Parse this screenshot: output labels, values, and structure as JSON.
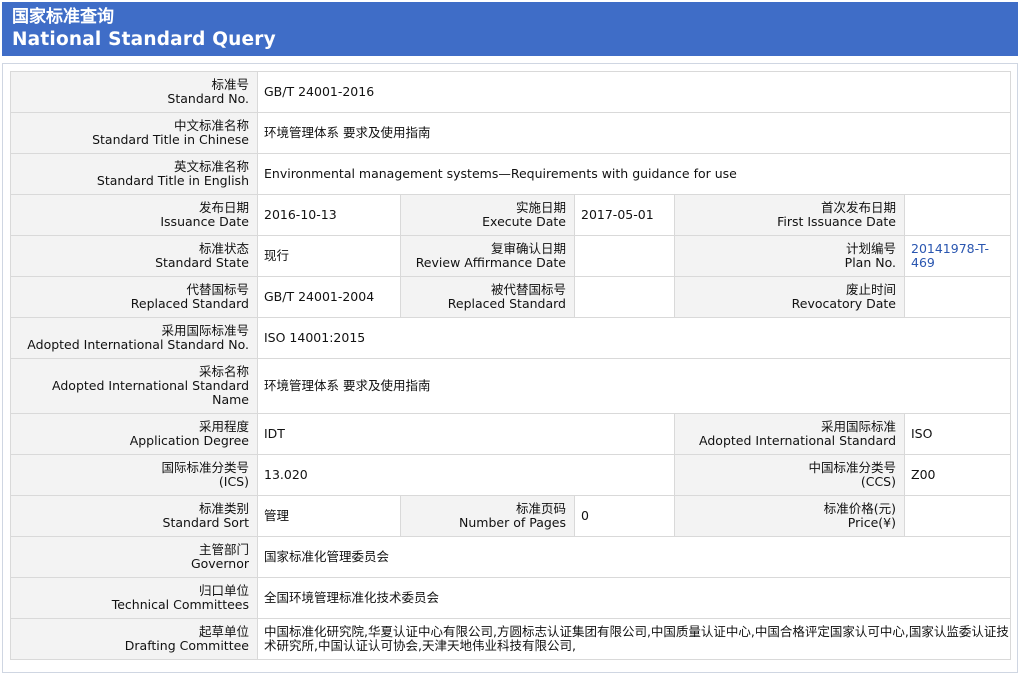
{
  "header": {
    "title_cn": "国家标准查询",
    "title_en": "National Standard Query"
  },
  "rows": {
    "standard_no": {
      "cn": "标准号",
      "en": "Standard No.",
      "value": "GB/T 24001-2016"
    },
    "title_cn": {
      "cn": "中文标准名称",
      "en": "Standard Title in Chinese",
      "value": "环境管理体系 要求及使用指南"
    },
    "title_en": {
      "cn": "英文标准名称",
      "en": "Standard Title in English",
      "value": "Environmental management systems—Requirements with guidance for use"
    },
    "issuance": {
      "cn": "发布日期",
      "en": "Issuance Date",
      "value": "2016-10-13"
    },
    "execute": {
      "cn": "实施日期",
      "en": "Execute Date",
      "value": "2017-05-01"
    },
    "first_issuance": {
      "cn": "首次发布日期",
      "en": "First Issuance Date",
      "value": ""
    },
    "state": {
      "cn": "标准状态",
      "en": "Standard State",
      "value": "现行"
    },
    "review": {
      "cn": "复审确认日期",
      "en": "Review Affirmance Date",
      "value": ""
    },
    "plan_no": {
      "cn": "计划编号",
      "en": "Plan No.",
      "value_line1": "20141978-T-",
      "value_line2": "469"
    },
    "replaced": {
      "cn": "代替国标号",
      "en": "Replaced Standard",
      "value": "GB/T 24001-2004"
    },
    "replaced_by": {
      "cn": "被代替国标号",
      "en": "Replaced Standard",
      "value": ""
    },
    "revocatory": {
      "cn": "废止时间",
      "en": "Revocatory Date",
      "value": ""
    },
    "adopted_no": {
      "cn": "采用国际标准号",
      "en": "Adopted International Standard No.",
      "value": "ISO 14001:2015"
    },
    "adopted_name": {
      "cn": "采标名称",
      "en_line1": "Adopted International Standard",
      "en_line2": "Name",
      "value": "环境管理体系 要求及使用指南"
    },
    "degree": {
      "cn": "采用程度",
      "en": "Application Degree",
      "value": "IDT"
    },
    "adopted_std": {
      "cn": "采用国际标准",
      "en": "Adopted International Standard",
      "value": "ISO"
    },
    "ics": {
      "cn": "国际标准分类号",
      "en": "(ICS)",
      "value": "13.020"
    },
    "ccs": {
      "cn": "中国标准分类号",
      "en": "(CCS)",
      "value": "Z00"
    },
    "sort": {
      "cn": "标准类别",
      "en": "Standard Sort",
      "value": "管理"
    },
    "pages": {
      "cn": "标准页码",
      "en": "Number of Pages",
      "value": "0"
    },
    "price": {
      "cn": "标准价格(元)",
      "en": "Price(¥)",
      "value": ""
    },
    "governor": {
      "cn": "主管部门",
      "en": "Governor",
      "value": "国家标准化管理委员会"
    },
    "tech": {
      "cn": "归口单位",
      "en": "Technical Committees",
      "value": "全国环境管理标准化技术委员会"
    },
    "drafting": {
      "cn": "起草单位",
      "en": "Drafting Committee",
      "value": "中国标准化研究院,华夏认证中心有限公司,方圆标志认证集团有限公司,中国质量认证中心,中国合格评定国家认可中心,国家认监委认证技术研究所,中国认证认可协会,天津天地伟业科技有限公司,"
    }
  }
}
